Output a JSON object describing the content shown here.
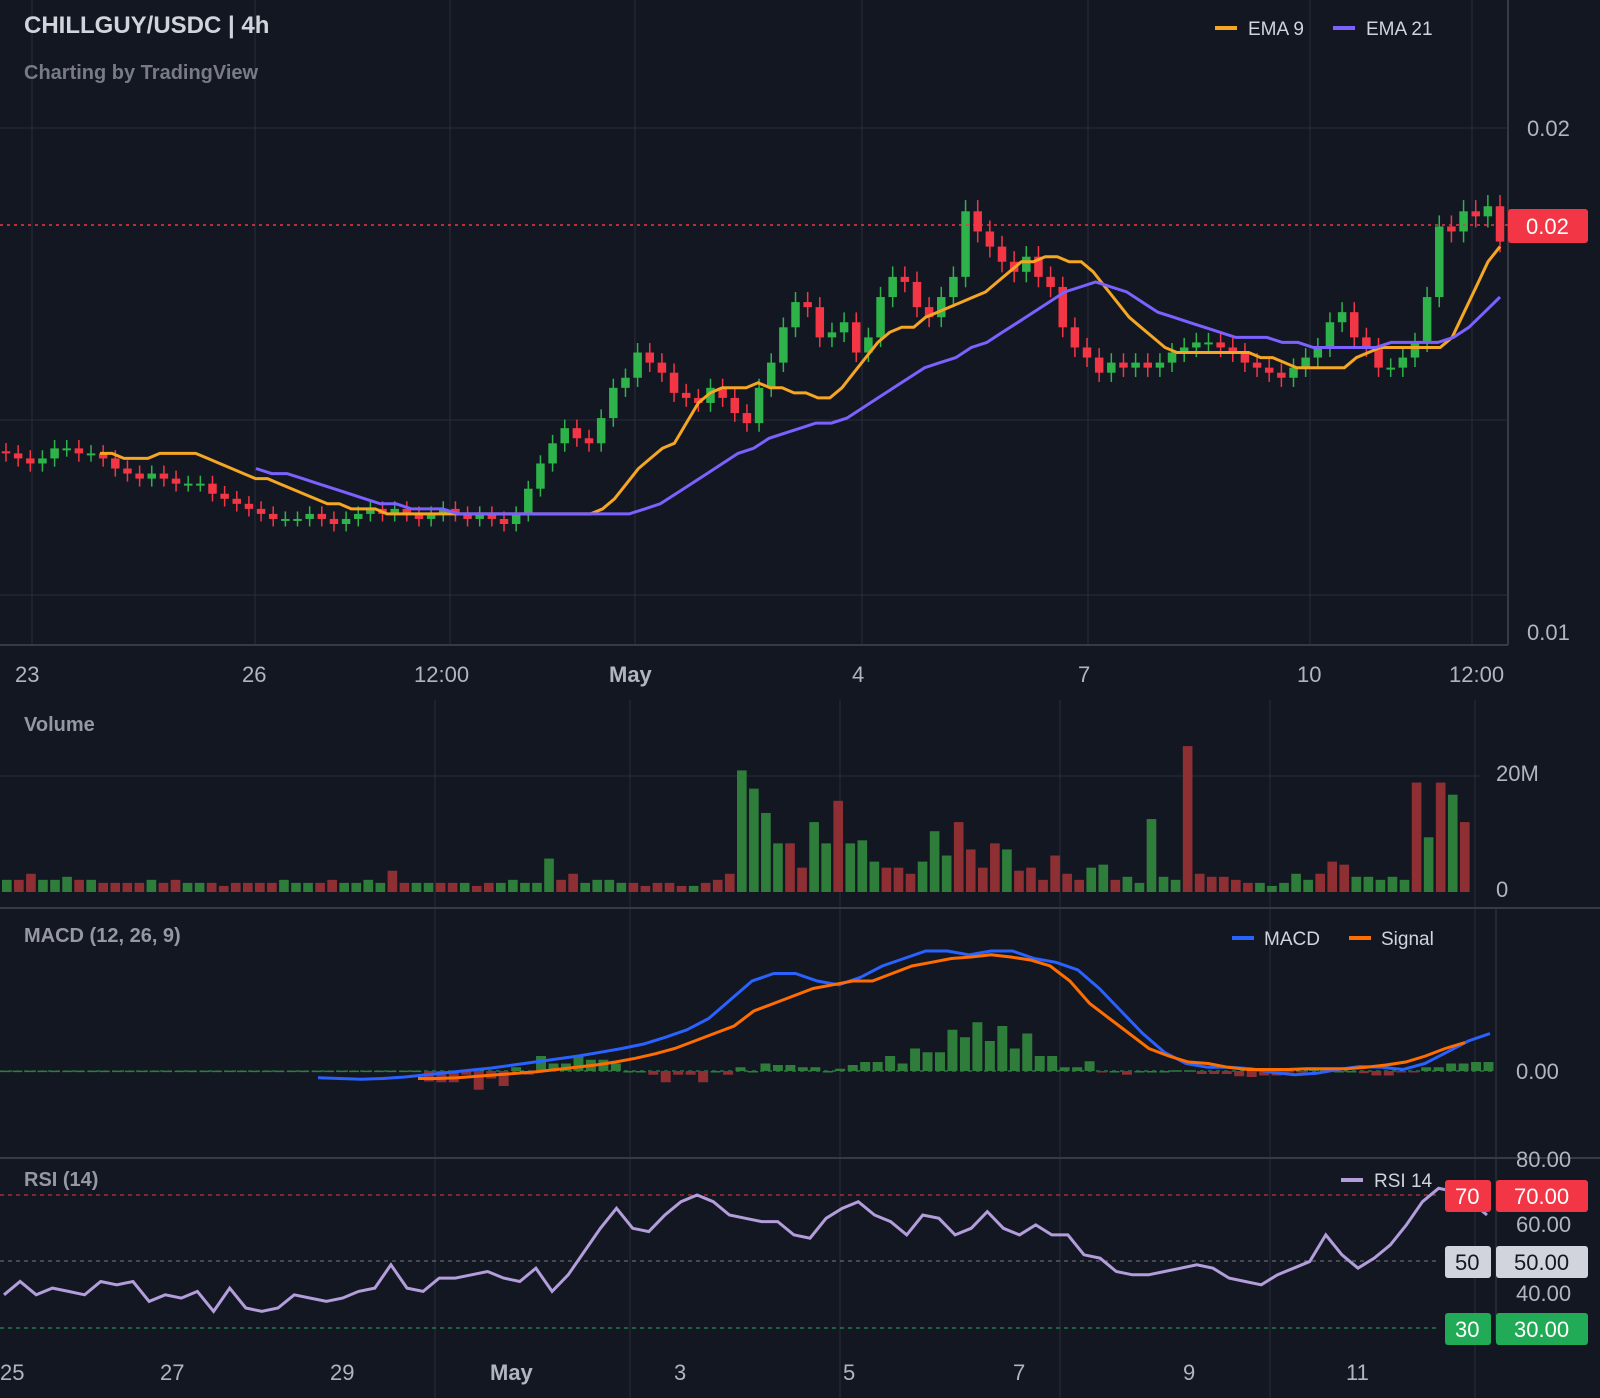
{
  "header": {
    "title": "CHILLGUY/USDC | 4h",
    "subtitle": "Charting by TradingView"
  },
  "price_panel": {
    "legend": [
      {
        "name": "EMA 9",
        "color": "#f5a623"
      },
      {
        "name": "EMA 21",
        "color": "#7b61ff"
      }
    ],
    "y_ticks": [
      "0.02",
      "0.01"
    ],
    "last_price_label": "0.02",
    "x_ticks": [
      "23",
      "26",
      "12:00",
      "May",
      "4",
      "7",
      "10",
      "12:00"
    ]
  },
  "volume_panel": {
    "title": "Volume",
    "y_ticks": [
      "20M",
      "0"
    ]
  },
  "macd_panel": {
    "title": "MACD (12, 26, 9)",
    "legend": [
      {
        "name": "MACD",
        "color": "#2962ff"
      },
      {
        "name": "Signal",
        "color": "#ff6d00"
      }
    ],
    "y_tick": "0.00"
  },
  "rsi_panel": {
    "title": "RSI (14)",
    "legend": [
      {
        "name": "RSI 14",
        "color": "#b39ddb"
      }
    ],
    "y_ticks": [
      "80.00",
      "60.00",
      "40.00"
    ],
    "badges": [
      {
        "left": "70",
        "right": "70.00",
        "color": "#f23645",
        "level": 70
      },
      {
        "left": "50",
        "right": "50.00",
        "color": "#d1d4dc",
        "level": 50
      },
      {
        "left": "30",
        "right": "30.00",
        "color": "#22ab56",
        "level": 30
      }
    ],
    "x_ticks": [
      "25",
      "27",
      "29",
      "May",
      "3",
      "5",
      "7",
      "9",
      "11"
    ]
  },
  "colors": {
    "up": "#26a69a",
    "up_candle": "#2db34a",
    "down": "#f23645",
    "background": "#131722",
    "grid": "#2a2e39"
  },
  "chart_data": [
    {
      "type": "candlestick",
      "title": "CHILLGUY/USDC | 4h",
      "interval": "4h",
      "ylim": [
        0.01,
        0.0215
      ],
      "series": [
        {
          "name": "Price",
          "ohlc_note": "approximate",
          "close": [
            0.0137,
            0.0136,
            0.0135,
            0.0136,
            0.0138,
            0.0138,
            0.0137,
            0.0137,
            0.0136,
            0.0134,
            0.0133,
            0.0132,
            0.0133,
            0.0132,
            0.0131,
            0.0131,
            0.0131,
            0.0129,
            0.0128,
            0.0127,
            0.0126,
            0.0125,
            0.0124,
            0.0124,
            0.0124,
            0.0125,
            0.0124,
            0.0123,
            0.0124,
            0.0125,
            0.0126,
            0.0125,
            0.0126,
            0.0125,
            0.0124,
            0.0125,
            0.0126,
            0.0125,
            0.0124,
            0.0125,
            0.0124,
            0.0123,
            0.0125,
            0.013,
            0.0135,
            0.0139,
            0.0142,
            0.014,
            0.0139,
            0.0144,
            0.015,
            0.0152,
            0.0157,
            0.0155,
            0.0153,
            0.0149,
            0.0148,
            0.0147,
            0.015,
            0.0148,
            0.0145,
            0.0143,
            0.015,
            0.0155,
            0.0162,
            0.0167,
            0.0166,
            0.016,
            0.0161,
            0.0163,
            0.0157,
            0.016,
            0.0168,
            0.0172,
            0.0171,
            0.0166,
            0.0164,
            0.0168,
            0.0172,
            0.0185,
            0.0181,
            0.0178,
            0.0175,
            0.0173,
            0.0176,
            0.0172,
            0.017,
            0.0162,
            0.0158,
            0.0156,
            0.0153,
            0.0155,
            0.0154,
            0.0155,
            0.0154,
            0.0155,
            0.0157,
            0.0158,
            0.0159,
            0.0159,
            0.0158,
            0.0157,
            0.0155,
            0.0154,
            0.0153,
            0.0152,
            0.0154,
            0.0156,
            0.0158,
            0.0163,
            0.0165,
            0.016,
            0.0158,
            0.0154,
            0.0154,
            0.0156,
            0.0159,
            0.0168,
            0.0182,
            0.0181,
            0.0185,
            0.0184,
            0.0186,
            0.0179
          ]
        },
        {
          "name": "EMA 9",
          "values": [
            0.0137,
            0.0137,
            0.0136,
            0.0136,
            0.0136,
            0.0137,
            0.0137,
            0.0137,
            0.0137,
            0.0136,
            0.0135,
            0.0134,
            0.0133,
            0.0132,
            0.0132,
            0.0131,
            0.013,
            0.0129,
            0.0128,
            0.0127,
            0.0127,
            0.0126,
            0.0126,
            0.0126,
            0.0125,
            0.0125,
            0.0125,
            0.0125,
            0.0125,
            0.0125,
            0.0125,
            0.0125,
            0.0125,
            0.0125,
            0.0125,
            0.0125,
            0.0125,
            0.0125,
            0.0125,
            0.0125,
            0.0125,
            0.0125,
            0.0126,
            0.0128,
            0.0131,
            0.0134,
            0.0136,
            0.0138,
            0.0139,
            0.0143,
            0.0147,
            0.0149,
            0.015,
            0.015,
            0.015,
            0.0151,
            0.015,
            0.015,
            0.0149,
            0.0149,
            0.0148,
            0.0148,
            0.015,
            0.0153,
            0.0156,
            0.0159,
            0.0161,
            0.0162,
            0.0162,
            0.0164,
            0.0165,
            0.0166,
            0.0167,
            0.0168,
            0.0169,
            0.0171,
            0.0173,
            0.0175,
            0.0175,
            0.0176,
            0.0176,
            0.0175,
            0.0175,
            0.0173,
            0.017,
            0.0167,
            0.0164,
            0.0162,
            0.016,
            0.0158,
            0.0157,
            0.0157,
            0.0157,
            0.0157,
            0.0157,
            0.0157,
            0.0157,
            0.0156,
            0.0156,
            0.0155,
            0.0154,
            0.0154,
            0.0154,
            0.0154,
            0.0154,
            0.0156,
            0.0157,
            0.0158,
            0.0158,
            0.0158,
            0.0158,
            0.0158,
            0.0158,
            0.016,
            0.0165,
            0.017,
            0.0175,
            0.0178
          ]
        },
        {
          "name": "EMA 21",
          "values": [
            0.0134,
            0.0133,
            0.0133,
            0.0132,
            0.0131,
            0.013,
            0.0129,
            0.0128,
            0.0127,
            0.0127,
            0.0126,
            0.0126,
            0.0126,
            0.0125,
            0.0125,
            0.0125,
            0.0125,
            0.0125,
            0.0125,
            0.0125,
            0.0125,
            0.0125,
            0.0125,
            0.0125,
            0.0125,
            0.0126,
            0.0127,
            0.0129,
            0.0131,
            0.0133,
            0.0135,
            0.0137,
            0.0138,
            0.014,
            0.0141,
            0.0142,
            0.0143,
            0.0143,
            0.0144,
            0.0146,
            0.0148,
            0.015,
            0.0152,
            0.0154,
            0.0155,
            0.0156,
            0.0158,
            0.0159,
            0.0161,
            0.0163,
            0.0165,
            0.0167,
            0.0169,
            0.017,
            0.0171,
            0.017,
            0.0169,
            0.0167,
            0.0165,
            0.0164,
            0.0163,
            0.0162,
            0.0161,
            0.016,
            0.016,
            0.016,
            0.0159,
            0.0159,
            0.0158,
            0.0158,
            0.0158,
            0.0158,
            0.0158,
            0.0159,
            0.0159,
            0.0159,
            0.0159,
            0.016,
            0.0162,
            0.0165,
            0.0168
          ]
        }
      ]
    },
    {
      "type": "bar",
      "title": "Volume",
      "ylim": [
        0,
        25000000
      ],
      "values_note": "approximate, in units",
      "series": [
        {
          "name": "Volume",
          "values": [
            2000000,
            2000000,
            3000000,
            2000000,
            2000000,
            2500000,
            2000000,
            2000000,
            1500000,
            1500000,
            1500000,
            1500000,
            2000000,
            1500000,
            2000000,
            1500000,
            1500000,
            1500000,
            1000000,
            1500000,
            1500000,
            1500000,
            1500000,
            2000000,
            1500000,
            1500000,
            1500000,
            2000000,
            1500000,
            1500000,
            2000000,
            1500000,
            3500000,
            1500000,
            1500000,
            1500000,
            1500000,
            1500000,
            1500000,
            1000000,
            1500000,
            1500000,
            2000000,
            1500000,
            1500000,
            5500000,
            2000000,
            3000000,
            1500000,
            2000000,
            2000000,
            1500000,
            1500000,
            1000000,
            1500000,
            1500000,
            1000000,
            1000000,
            1500000,
            2000000,
            3000000,
            20000000,
            17000000,
            13000000,
            8000000,
            8000000,
            4000000,
            11500000,
            8000000,
            15000000,
            8000000,
            8500000,
            5000000,
            4000000,
            4000000,
            3000000,
            5000000,
            10000000,
            6000000,
            11500000,
            7000000,
            4000000,
            8000000,
            7000000,
            3500000,
            4000000,
            2000000,
            6000000,
            3000000,
            2000000,
            4000000,
            4500000,
            2000000,
            2500000,
            1500000,
            12000000,
            2500000,
            2000000,
            24000000,
            3000000,
            2500000,
            2500000,
            2000000,
            1500000,
            1500000,
            1000000,
            1500000,
            3000000,
            2000000,
            3000000,
            5000000,
            4500000,
            2500000,
            2500000,
            2000000,
            2500000,
            2000000,
            18000000,
            9000000,
            18000000,
            16000000,
            11500000
          ]
        }
      ]
    },
    {
      "type": "line",
      "title": "MACD (12, 26, 9)",
      "series": [
        {
          "name": "MACD",
          "values": [
            -9e-05,
            -0.0001,
            -0.00011,
            -0.0001,
            -8e-05,
            -5e-05,
            -2e-05,
            1e-05,
            4e-05,
            8e-05,
            0.00012,
            0.00016,
            0.0002,
            0.00025,
            0.0003,
            0.00036,
            0.00045,
            0.00055,
            0.0007,
            0.00095,
            0.0012,
            0.0013,
            0.0013,
            0.0012,
            0.00115,
            0.00125,
            0.0014,
            0.0015,
            0.0016,
            0.0016,
            0.00155,
            0.0016,
            0.0016,
            0.0015,
            0.00145,
            0.00135,
            0.0011,
            0.0008,
            0.0005,
            0.00025,
            0.0001,
            5e-05,
            5e-05,
            3e-05,
            -2e-05,
            -5e-05,
            -3e-05,
            2e-05,
            6e-05,
            5e-05,
            2e-05,
            0.0001,
            0.00025,
            0.0004,
            0.0005
          ]
        },
        {
          "name": "Signal",
          "values": [
            -0.0001,
            -0.0001,
            -9e-05,
            -7e-05,
            -5e-05,
            -3e-05,
            -1e-05,
            2e-05,
            5e-05,
            8e-05,
            0.00012,
            0.00017,
            0.00023,
            0.0003,
            0.0004,
            0.0005,
            0.0006,
            0.0008,
            0.0009,
            0.001,
            0.0011,
            0.00115,
            0.0012,
            0.0012,
            0.0013,
            0.0014,
            0.00145,
            0.0015,
            0.00152,
            0.00155,
            0.00152,
            0.00148,
            0.0014,
            0.0012,
            0.0009,
            0.0007,
            0.0005,
            0.0003,
            0.0002,
            0.00012,
            0.0001,
            5e-05,
            2e-05,
            2e-05,
            2e-05,
            3e-05,
            3e-05,
            3e-05,
            5e-05,
            8e-05,
            0.00012,
            0.0002,
            0.0003,
            0.00038
          ]
        }
      ],
      "y_ticks": [
        0.0
      ]
    },
    {
      "type": "line",
      "title": "RSI (14)",
      "ylim": [
        28,
        80
      ],
      "x_ticks": [
        "25",
        "27",
        "29",
        "May",
        "3",
        "5",
        "7",
        "9",
        "11"
      ],
      "series": [
        {
          "name": "RSI 14",
          "values": [
            40,
            44,
            40,
            42,
            41,
            40,
            44,
            43,
            44,
            38,
            40,
            39,
            41,
            35,
            42,
            36,
            35,
            36,
            40,
            39,
            38,
            39,
            41,
            42,
            49,
            42,
            41,
            45,
            45,
            46,
            47,
            45,
            44,
            48,
            41,
            46,
            53,
            60,
            66,
            60,
            59,
            64,
            68,
            70,
            68,
            64,
            63,
            62,
            62,
            58,
            57,
            63,
            66,
            68,
            64,
            62,
            58,
            64,
            63,
            58,
            60,
            65,
            60,
            58,
            61,
            58,
            58,
            52,
            51,
            47,
            46,
            46,
            47,
            48,
            49,
            48,
            45,
            44,
            43,
            46,
            48,
            50,
            58,
            52,
            48,
            51,
            55,
            61,
            68,
            72,
            71,
            68,
            64
          ]
        }
      ]
    }
  ]
}
